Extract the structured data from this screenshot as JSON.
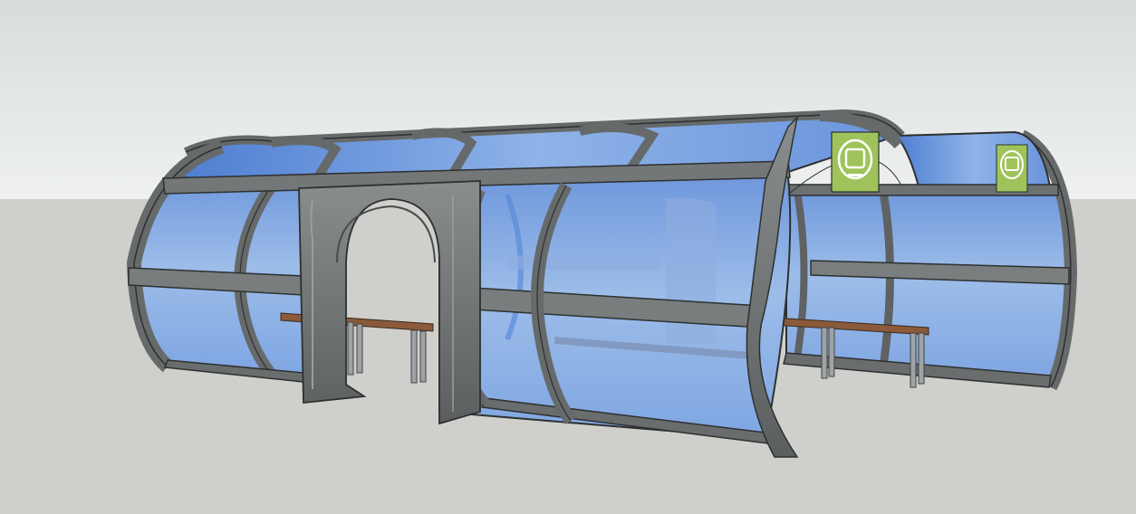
{
  "scene": {
    "subject": "",
    "colors": {
      "sky_top": "#dcdfe0",
      "sky_bottom": "#eef0f0",
      "ground": "#cfcfcc",
      "frame": "#6b6e6e",
      "frame_light": "#8c8f8f",
      "frame_edge": "#2e3030",
      "glass_light": "#b8d2f2",
      "glass_mid": "#7fa6e2",
      "glass_dark": "#4d7bd0",
      "bench_wood": "#8a5a3a",
      "bench_leg": "#9ea3a6",
      "logo_bg": "#9fc35a",
      "logo_fg": "#ffffff"
    },
    "icons": [
      "bus-logo-icon",
      "bus-logo-icon"
    ]
  }
}
